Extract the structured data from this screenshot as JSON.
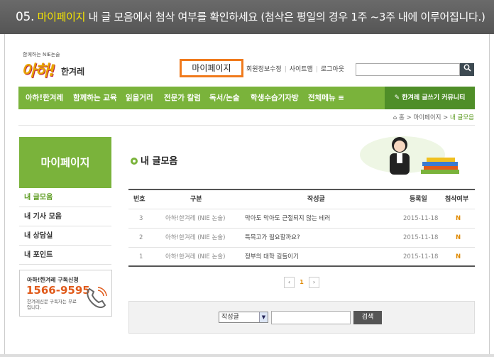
{
  "banner": {
    "step": "05.",
    "highlight": "마이페이지",
    "text": " 내 글 모음에서 첨삭 여부를 확인하세요 (첨삭은 평일의 경우 1주 ~3주 내에 이루어집니다.)"
  },
  "logo": {
    "tagline": "함께하는 NIE논술",
    "main": "아하!",
    "sub": "한겨레"
  },
  "header": {
    "mypage_label": "마이페이지",
    "links": [
      "회원정보수정",
      "사이트맵",
      "로그아웃"
    ],
    "search_placeholder": "",
    "search_icon": "search-icon"
  },
  "nav": {
    "items": [
      "아하!한겨레",
      "함께하는 교육",
      "읽을거리",
      "전문가 칼럼",
      "독서/논술",
      "학생수습기자방",
      "전체메뉴 ≡"
    ],
    "write_button": "✎ 한겨레 글쓰기 커뮤니티"
  },
  "breadcrumb": {
    "home": "홈",
    "path1": "마이페이지",
    "current": "내 글모음"
  },
  "sidebar": {
    "title": "마이페이지",
    "items": [
      {
        "label": "내 글모음"
      },
      {
        "label": "내 기사 모음"
      },
      {
        "label": "내 상담실"
      },
      {
        "label": "내 포인트"
      }
    ],
    "promo": {
      "title": "아하!한겨레 구독신청",
      "phone": "1566-9595",
      "note": "한겨레신문 구독자는 무료입니다."
    }
  },
  "main": {
    "title": "내 글모음",
    "table": {
      "headers": [
        "번호",
        "구분",
        "작성글",
        "등록일",
        "첨삭여부"
      ],
      "rows": [
        {
          "num": "3",
          "category": "아하!한겨레 (NIE 논술)",
          "subject": "막아도 막아도 근절되지 않는 테러",
          "date": "2015-11-18",
          "status": "N"
        },
        {
          "num": "2",
          "category": "아하!한겨레 (NIE 논술)",
          "subject": "특목고가 필요할까요?",
          "date": "2015-11-18",
          "status": "N"
        },
        {
          "num": "1",
          "category": "아하!한겨레 (NIE 논술)",
          "subject": "정부의 대학 길들이기",
          "date": "2015-11-18",
          "status": "N"
        }
      ]
    },
    "pager": {
      "prev": "‹",
      "current": "1",
      "next": "›"
    },
    "search": {
      "select_value": "작성글",
      "keyword": "",
      "button": "검색"
    }
  },
  "colors": {
    "accent_green": "#7ab33b",
    "dark_green": "#4f8e28",
    "highlight_orange": "#f07a1c",
    "banner_yellow": "#f5e400"
  }
}
